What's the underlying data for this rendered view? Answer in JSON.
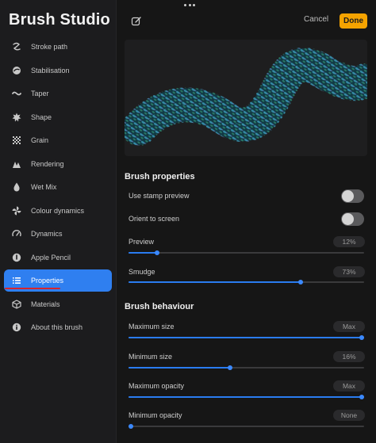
{
  "sidebar": {
    "title": "Brush Studio",
    "items": [
      {
        "label": "Stroke path",
        "icon": "stroke-path-icon"
      },
      {
        "label": "Stabilisation",
        "icon": "stabilisation-icon"
      },
      {
        "label": "Taper",
        "icon": "taper-icon"
      },
      {
        "label": "Shape",
        "icon": "shape-icon"
      },
      {
        "label": "Grain",
        "icon": "grain-icon"
      },
      {
        "label": "Rendering",
        "icon": "rendering-icon"
      },
      {
        "label": "Wet Mix",
        "icon": "droplet-icon"
      },
      {
        "label": "Colour dynamics",
        "icon": "colour-dynamics-icon"
      },
      {
        "label": "Dynamics",
        "icon": "gauge-icon"
      },
      {
        "label": "Apple Pencil",
        "icon": "pencil-icon"
      },
      {
        "label": "Properties",
        "icon": "list-icon"
      },
      {
        "label": "Materials",
        "icon": "cube-icon"
      },
      {
        "label": "About this brush",
        "icon": "info-icon"
      }
    ],
    "active_index": 10
  },
  "header": {
    "cancel_label": "Cancel",
    "done_label": "Done"
  },
  "colors": {
    "accent": "#2f7ff0",
    "done": "#f5a300",
    "annotation": "#d6262c"
  },
  "brush_properties": {
    "title": "Brush properties",
    "use_stamp_preview": {
      "label": "Use stamp preview",
      "on": false
    },
    "orient_to_screen": {
      "label": "Orient to screen",
      "on": false
    },
    "preview": {
      "label": "Preview",
      "value": "12%",
      "fraction": 0.12
    },
    "smudge": {
      "label": "Smudge",
      "value": "73%",
      "fraction": 0.73
    }
  },
  "brush_behaviour": {
    "title": "Brush behaviour",
    "maximum_size": {
      "label": "Maximum size",
      "value": "Max",
      "fraction": 1.0
    },
    "minimum_size": {
      "label": "Minimum size",
      "value": "16%",
      "fraction": 0.43
    },
    "maximum_opacity": {
      "label": "Maximum opacity",
      "value": "Max",
      "fraction": 1.0
    },
    "minimum_opacity": {
      "label": "Minimum opacity",
      "value": "None",
      "fraction": 0.0
    }
  }
}
